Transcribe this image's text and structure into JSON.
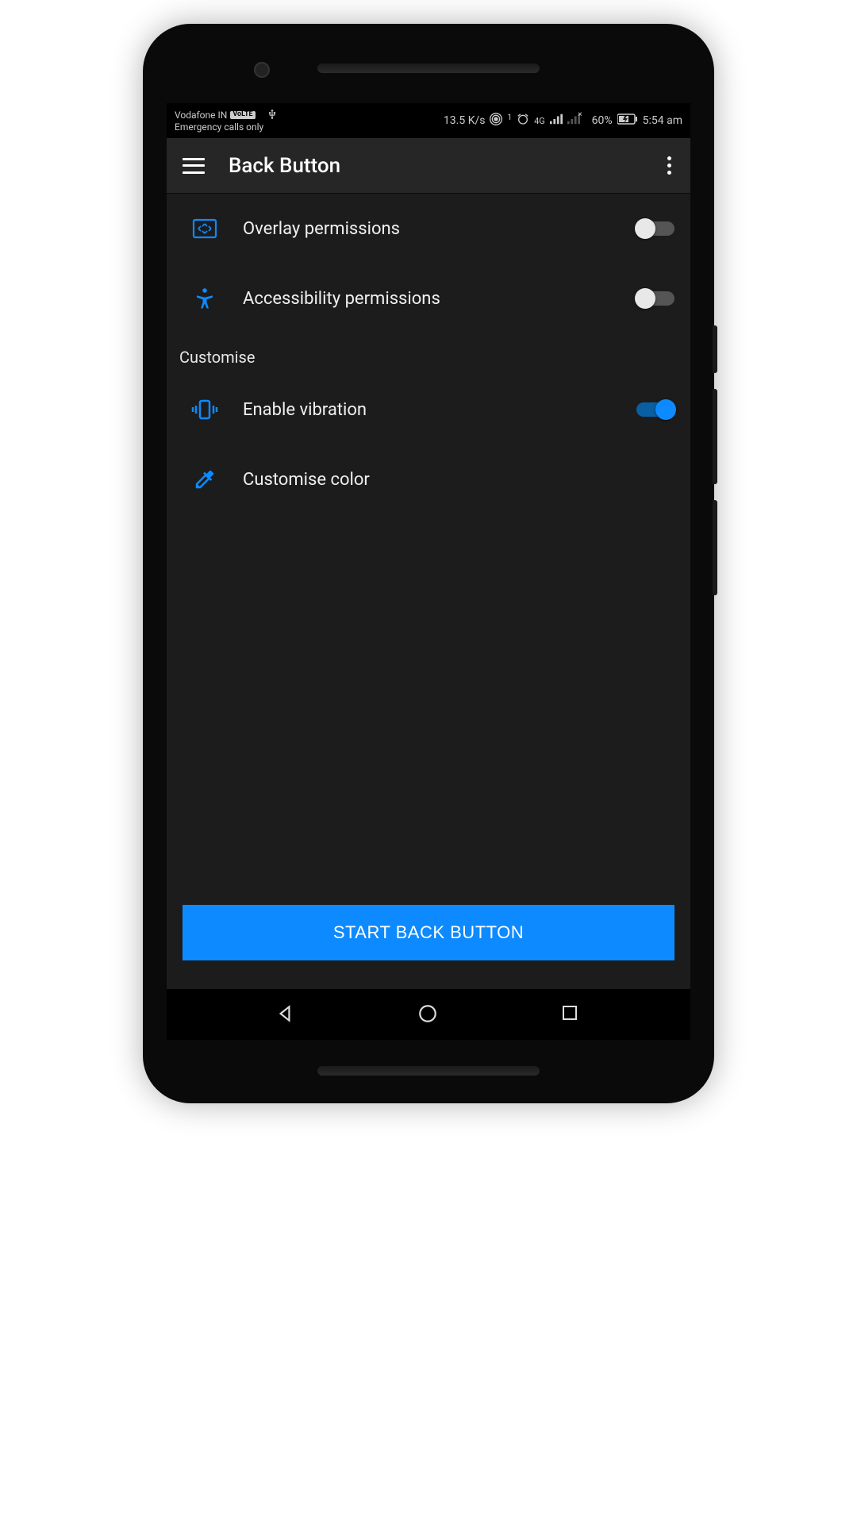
{
  "status_bar": {
    "carrier": "Vodafone IN",
    "volte": "VoLTE",
    "emergency": "Emergency calls only",
    "speed": "13.5 K/s",
    "network_gen": "4G",
    "battery_percent": "60%",
    "time": "5:54 am"
  },
  "app_bar": {
    "title": "Back Button"
  },
  "rows": {
    "overlay": {
      "label": "Overlay permissions",
      "enabled": false
    },
    "accessibility": {
      "label": "Accessibility permissions",
      "enabled": false
    },
    "vibration": {
      "label": "Enable vibration",
      "enabled": true
    },
    "color": {
      "label": "Customise color"
    }
  },
  "section": {
    "customise": "Customise"
  },
  "start_button": "START BACK BUTTON",
  "colors": {
    "accent": "#0d8aff"
  }
}
